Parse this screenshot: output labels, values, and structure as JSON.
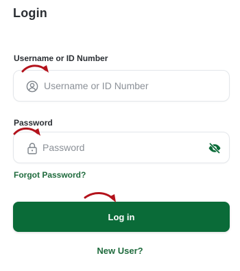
{
  "page": {
    "title": "Login"
  },
  "username": {
    "label": "Username or ID Number",
    "placeholder": "Username or ID Number",
    "value": "",
    "icon": "user-circle-icon"
  },
  "password": {
    "label": "Password",
    "placeholder": "Password",
    "value": "",
    "icon": "lock-icon",
    "toggle_icon": "eye-slash-icon"
  },
  "links": {
    "forgot_password": "Forgot Password?",
    "new_user": "New User?"
  },
  "actions": {
    "login_label": "Log in"
  },
  "annotations": {
    "arrow_icon": "red-curved-arrow-icon",
    "count": 3
  },
  "colors": {
    "primary": "#0a6b38",
    "link": "#1f6b3d",
    "annotation_arrow": "#b3121b",
    "field_border": "#e3e6ea",
    "placeholder": "#8b9097"
  }
}
